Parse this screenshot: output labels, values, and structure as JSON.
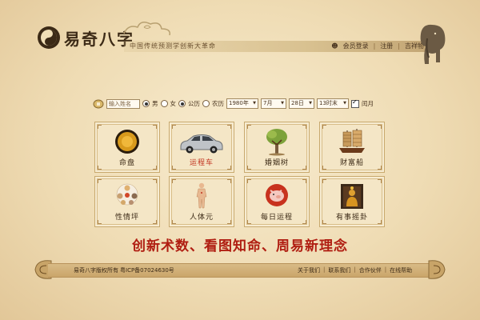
{
  "header": {
    "logo_text": "易奇八字",
    "tagline": "中国传统预测学创新大革命",
    "login_label": "会员登录",
    "register_label": "注册",
    "guide_label": "吉祥物"
  },
  "form": {
    "name_placeholder": "输入姓名",
    "gender_male": "男",
    "gender_female": "女",
    "cal_solar": "公历",
    "cal_lunar": "农历",
    "year": "1980年",
    "month": "7月",
    "day": "28日",
    "hour": "13时末",
    "leap_label": "闰月"
  },
  "tiles": [
    {
      "label": "命盘"
    },
    {
      "label": "运程车"
    },
    {
      "label": "婚姻树"
    },
    {
      "label": "财富船"
    },
    {
      "label": "性情坪"
    },
    {
      "label": "人体元"
    },
    {
      "label": "每日运程"
    },
    {
      "label": "有事摇卦"
    }
  ],
  "slogan": "创新术数、看图知命、周易新理念",
  "footer": {
    "copyright": "易奇八字版权所有",
    "icp": "粤ICP备07024630号",
    "links": [
      "关于我们",
      "联系我们",
      "合作伙伴",
      "在线帮助"
    ]
  },
  "colors": {
    "accent_red": "#b01e12",
    "active_label": "#c0331f",
    "background": "#efdcb4"
  }
}
